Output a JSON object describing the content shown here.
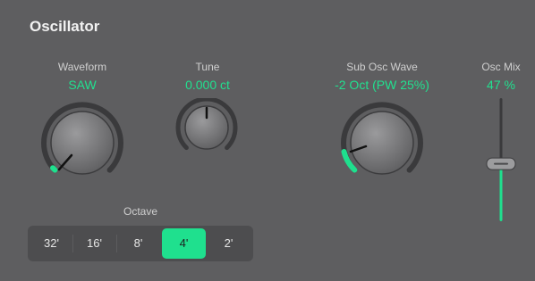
{
  "panel": {
    "title": "Oscillator"
  },
  "waveform": {
    "label": "Waveform",
    "value": "SAW"
  },
  "tune": {
    "label": "Tune",
    "value": "0.000 ct"
  },
  "sub_osc": {
    "label": "Sub Osc Wave",
    "value": "-2 Oct (PW 25%)"
  },
  "osc_mix": {
    "label": "Osc Mix",
    "value": "47 %",
    "level": 0.47
  },
  "octave": {
    "label": "Octave",
    "options": [
      "32'",
      "16'",
      "8'",
      "4'",
      "2'"
    ],
    "selected": "4'"
  },
  "colors": {
    "accent": "#1fe08e",
    "background": "#5e5e60"
  }
}
